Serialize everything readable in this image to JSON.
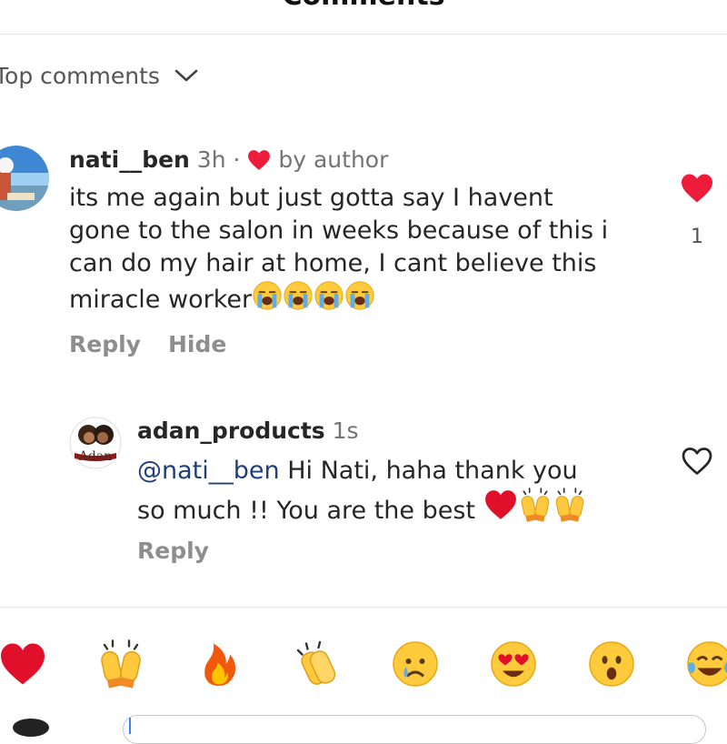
{
  "header": {
    "title": "Comments"
  },
  "sort": {
    "label": "Top comments"
  },
  "comments": [
    {
      "username": "nati__ben",
      "time": "3h",
      "separator": "·",
      "liked_by_author_label": "by author",
      "text_lines": [
        "its me again but just gotta say I havent",
        "gone to the salon in weeks because of this i",
        "can do my hair at home, I cant believe this",
        "miracle worker"
      ],
      "trailing_emojis": [
        "loudly-crying-face",
        "loudly-crying-face",
        "loudly-crying-face",
        "loudly-crying-face"
      ],
      "reply_label": "Reply",
      "hide_label": "Hide",
      "like_count": "1",
      "liked": true
    },
    {
      "username": "adan_products",
      "time": "1s",
      "avatar_text": "Adan",
      "mention": "@nati__ben",
      "text_line1_rest": " Hi Nati, haha thank you",
      "text_line2": "so much !! You are the best ",
      "trailing_emojis": [
        "red-heart",
        "raising-hands",
        "raising-hands"
      ],
      "reply_label": "Reply",
      "liked": false
    }
  ],
  "reactions": [
    "red-heart",
    "raising-hands",
    "fire",
    "clapping-hands",
    "crying-face",
    "heart-eyes-face",
    "surprised-face",
    "tears-of-joy-face"
  ],
  "colors": {
    "heart": "#ed1c3a",
    "text": "#262626",
    "muted": "#737373",
    "divider": "#e6e6e6"
  }
}
